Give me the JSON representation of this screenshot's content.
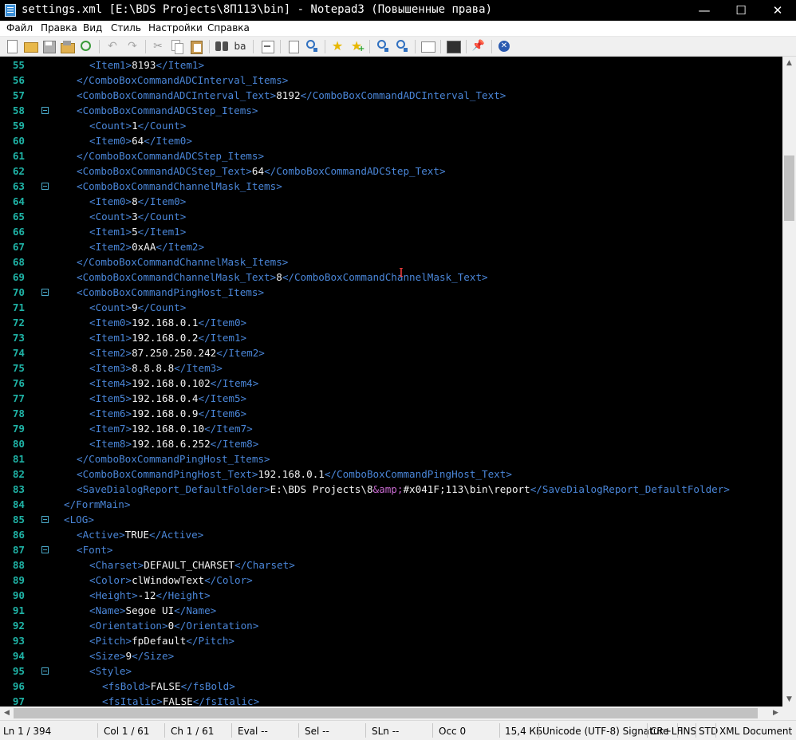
{
  "window": {
    "title": "settings.xml [E:\\BDS Projects\\8П113\\bin] - Notepad3 (Повышенные права)",
    "minimize_glyph": "—",
    "maximize_glyph": "☐",
    "close_glyph": "✕"
  },
  "menu": {
    "items": [
      "Файл",
      "Правка",
      "Вид",
      "Стиль",
      "Настройки",
      "Справка"
    ]
  },
  "toolbar": {
    "icons": [
      "new-file-icon",
      "open-folder-icon",
      "save-icon",
      "save-as-icon",
      "revert-icon",
      "undo-icon",
      "redo-icon",
      "cut-icon",
      "copy-icon",
      "paste-icon",
      "find-icon",
      "replace-icon",
      "word-wrap-icon",
      "goto-icon",
      "search-web-icon",
      "favorite-star-icon",
      "add-favorite-icon",
      "zoom-in-icon",
      "zoom-out-icon",
      "schema-icon",
      "console-icon",
      "pin-icon",
      "close-document-icon"
    ]
  },
  "editor": {
    "lines": [
      {
        "n": "55",
        "fold": false,
        "indent": 2,
        "tokens": [
          [
            "tag",
            "<Item1>"
          ],
          [
            "val",
            "8193"
          ],
          [
            "tag",
            "</Item1>"
          ]
        ]
      },
      {
        "n": "56",
        "fold": false,
        "indent": 1,
        "tokens": [
          [
            "tag",
            "</ComboBoxCommandADCInterval_Items>"
          ]
        ]
      },
      {
        "n": "57",
        "fold": false,
        "indent": 1,
        "tokens": [
          [
            "tag",
            "<ComboBoxCommandADCInterval_Text>"
          ],
          [
            "val",
            "8192"
          ],
          [
            "tag",
            "</ComboBoxCommandADCInterval_Text>"
          ]
        ]
      },
      {
        "n": "58",
        "fold": true,
        "indent": 1,
        "tokens": [
          [
            "tag",
            "<ComboBoxCommandADCStep_Items>"
          ]
        ]
      },
      {
        "n": "59",
        "fold": false,
        "indent": 2,
        "tokens": [
          [
            "tag",
            "<Count>"
          ],
          [
            "val",
            "1"
          ],
          [
            "tag",
            "</Count>"
          ]
        ]
      },
      {
        "n": "60",
        "fold": false,
        "indent": 2,
        "tokens": [
          [
            "tag",
            "<Item0>"
          ],
          [
            "val",
            "64"
          ],
          [
            "tag",
            "</Item0>"
          ]
        ]
      },
      {
        "n": "61",
        "fold": false,
        "indent": 1,
        "tokens": [
          [
            "tag",
            "</ComboBoxCommandADCStep_Items>"
          ]
        ]
      },
      {
        "n": "62",
        "fold": false,
        "indent": 1,
        "tokens": [
          [
            "tag",
            "<ComboBoxCommandADCStep_Text>"
          ],
          [
            "val",
            "64"
          ],
          [
            "tag",
            "</ComboBoxCommandADCStep_Text>"
          ]
        ]
      },
      {
        "n": "63",
        "fold": true,
        "indent": 1,
        "tokens": [
          [
            "tag",
            "<ComboBoxCommandChannelMask_Items>"
          ]
        ]
      },
      {
        "n": "64",
        "fold": false,
        "indent": 2,
        "tokens": [
          [
            "tag",
            "<Item0>"
          ],
          [
            "val",
            "8"
          ],
          [
            "tag",
            "</Item0>"
          ]
        ]
      },
      {
        "n": "65",
        "fold": false,
        "indent": 2,
        "tokens": [
          [
            "tag",
            "<Count>"
          ],
          [
            "val",
            "3"
          ],
          [
            "tag",
            "</Count>"
          ]
        ]
      },
      {
        "n": "66",
        "fold": false,
        "indent": 2,
        "tokens": [
          [
            "tag",
            "<Item1>"
          ],
          [
            "val",
            "5"
          ],
          [
            "tag",
            "</Item1>"
          ]
        ]
      },
      {
        "n": "67",
        "fold": false,
        "indent": 2,
        "tokens": [
          [
            "tag",
            "<Item2>"
          ],
          [
            "val",
            "0xAA"
          ],
          [
            "tag",
            "</Item2>"
          ]
        ]
      },
      {
        "n": "68",
        "fold": false,
        "indent": 1,
        "tokens": [
          [
            "tag",
            "</ComboBoxCommandChannelMask_Items>"
          ]
        ]
      },
      {
        "n": "69",
        "fold": false,
        "indent": 1,
        "tokens": [
          [
            "tag",
            "<ComboBoxCommandChannelMask_Text>"
          ],
          [
            "val",
            "8"
          ],
          [
            "tag",
            "</ComboBoxCommandChannelMask_Text>"
          ]
        ]
      },
      {
        "n": "70",
        "fold": true,
        "indent": 1,
        "tokens": [
          [
            "tag",
            "<ComboBoxCommandPingHost_Items>"
          ]
        ]
      },
      {
        "n": "71",
        "fold": false,
        "indent": 2,
        "tokens": [
          [
            "tag",
            "<Count>"
          ],
          [
            "val",
            "9"
          ],
          [
            "tag",
            "</Count>"
          ]
        ]
      },
      {
        "n": "72",
        "fold": false,
        "indent": 2,
        "tokens": [
          [
            "tag",
            "<Item0>"
          ],
          [
            "val",
            "192.168.0.1"
          ],
          [
            "tag",
            "</Item0>"
          ]
        ]
      },
      {
        "n": "73",
        "fold": false,
        "indent": 2,
        "tokens": [
          [
            "tag",
            "<Item1>"
          ],
          [
            "val",
            "192.168.0.2"
          ],
          [
            "tag",
            "</Item1>"
          ]
        ]
      },
      {
        "n": "74",
        "fold": false,
        "indent": 2,
        "tokens": [
          [
            "tag",
            "<Item2>"
          ],
          [
            "val",
            "87.250.250.242"
          ],
          [
            "tag",
            "</Item2>"
          ]
        ]
      },
      {
        "n": "75",
        "fold": false,
        "indent": 2,
        "tokens": [
          [
            "tag",
            "<Item3>"
          ],
          [
            "val",
            "8.8.8.8"
          ],
          [
            "tag",
            "</Item3>"
          ]
        ]
      },
      {
        "n": "76",
        "fold": false,
        "indent": 2,
        "tokens": [
          [
            "tag",
            "<Item4>"
          ],
          [
            "val",
            "192.168.0.102"
          ],
          [
            "tag",
            "</Item4>"
          ]
        ]
      },
      {
        "n": "77",
        "fold": false,
        "indent": 2,
        "tokens": [
          [
            "tag",
            "<Item5>"
          ],
          [
            "val",
            "192.168.0.4"
          ],
          [
            "tag",
            "</Item5>"
          ]
        ]
      },
      {
        "n": "78",
        "fold": false,
        "indent": 2,
        "tokens": [
          [
            "tag",
            "<Item6>"
          ],
          [
            "val",
            "192.168.0.9"
          ],
          [
            "tag",
            "</Item6>"
          ]
        ]
      },
      {
        "n": "79",
        "fold": false,
        "indent": 2,
        "tokens": [
          [
            "tag",
            "<Item7>"
          ],
          [
            "val",
            "192.168.0.10"
          ],
          [
            "tag",
            "</Item7>"
          ]
        ]
      },
      {
        "n": "80",
        "fold": false,
        "indent": 2,
        "tokens": [
          [
            "tag",
            "<Item8>"
          ],
          [
            "val",
            "192.168.6.252"
          ],
          [
            "tag",
            "</Item8>"
          ]
        ]
      },
      {
        "n": "81",
        "fold": false,
        "indent": 1,
        "tokens": [
          [
            "tag",
            "</ComboBoxCommandPingHost_Items>"
          ]
        ]
      },
      {
        "n": "82",
        "fold": false,
        "indent": 1,
        "tokens": [
          [
            "tag",
            "<ComboBoxCommandPingHost_Text>"
          ],
          [
            "val",
            "192.168.0.1"
          ],
          [
            "tag",
            "</ComboBoxCommandPingHost_Text>"
          ]
        ]
      },
      {
        "n": "83",
        "fold": false,
        "indent": 1,
        "tokens": [
          [
            "tag",
            "<SaveDialogReport_DefaultFolder>"
          ],
          [
            "val",
            "E:\\BDS Projects\\8"
          ],
          [
            "ent",
            "&amp;"
          ],
          [
            "val",
            "#x041F;113\\bin\\report"
          ],
          [
            "tag",
            "</SaveDialogReport_DefaultFolder>"
          ]
        ]
      },
      {
        "n": "84",
        "fold": false,
        "indent": 0,
        "tokens": [
          [
            "tag",
            "</FormMain>"
          ]
        ]
      },
      {
        "n": "85",
        "fold": true,
        "indent": 0,
        "tokens": [
          [
            "tag",
            "<LOG>"
          ]
        ]
      },
      {
        "n": "86",
        "fold": false,
        "indent": 1,
        "tokens": [
          [
            "tag",
            "<Active>"
          ],
          [
            "val",
            "TRUE"
          ],
          [
            "tag",
            "</Active>"
          ]
        ]
      },
      {
        "n": "87",
        "fold": true,
        "indent": 1,
        "tokens": [
          [
            "tag",
            "<Font>"
          ]
        ]
      },
      {
        "n": "88",
        "fold": false,
        "indent": 2,
        "tokens": [
          [
            "tag",
            "<Charset>"
          ],
          [
            "val",
            "DEFAULT_CHARSET"
          ],
          [
            "tag",
            "</Charset>"
          ]
        ]
      },
      {
        "n": "89",
        "fold": false,
        "indent": 2,
        "tokens": [
          [
            "tag",
            "<Color>"
          ],
          [
            "val",
            "clWindowText"
          ],
          [
            "tag",
            "</Color>"
          ]
        ]
      },
      {
        "n": "90",
        "fold": false,
        "indent": 2,
        "tokens": [
          [
            "tag",
            "<Height>"
          ],
          [
            "val",
            "-12"
          ],
          [
            "tag",
            "</Height>"
          ]
        ]
      },
      {
        "n": "91",
        "fold": false,
        "indent": 2,
        "tokens": [
          [
            "tag",
            "<Name>"
          ],
          [
            "val",
            "Segoe UI"
          ],
          [
            "tag",
            "</Name>"
          ]
        ]
      },
      {
        "n": "92",
        "fold": false,
        "indent": 2,
        "tokens": [
          [
            "tag",
            "<Orientation>"
          ],
          [
            "val",
            "0"
          ],
          [
            "tag",
            "</Orientation>"
          ]
        ]
      },
      {
        "n": "93",
        "fold": false,
        "indent": 2,
        "tokens": [
          [
            "tag",
            "<Pitch>"
          ],
          [
            "val",
            "fpDefault"
          ],
          [
            "tag",
            "</Pitch>"
          ]
        ]
      },
      {
        "n": "94",
        "fold": false,
        "indent": 2,
        "tokens": [
          [
            "tag",
            "<Size>"
          ],
          [
            "val",
            "9"
          ],
          [
            "tag",
            "</Size>"
          ]
        ]
      },
      {
        "n": "95",
        "fold": true,
        "indent": 2,
        "tokens": [
          [
            "tag",
            "<Style>"
          ]
        ]
      },
      {
        "n": "96",
        "fold": false,
        "indent": 3,
        "tokens": [
          [
            "tag",
            "<fsBold>"
          ],
          [
            "val",
            "FALSE"
          ],
          [
            "tag",
            "</fsBold>"
          ]
        ]
      },
      {
        "n": "97",
        "fold": false,
        "indent": 3,
        "tokens": [
          [
            "tag",
            "<fsItalic>"
          ],
          [
            "val",
            "FALSE"
          ],
          [
            "tag",
            "</fsItalic>"
          ]
        ]
      }
    ]
  },
  "statusbar": {
    "ln": "Ln 1 / 394",
    "col": "Col 1 / 61",
    "ch": "Ch 1 / 61",
    "eval": "Eval --",
    "sel": "Sel --",
    "sln": "SLn --",
    "occ": "Occ 0",
    "size": "15,4 КБ",
    "encoding": "Unicode (UTF-8) Signature",
    "eol": "CR+LF",
    "ins": "INS",
    "std": "STD",
    "lexer": "XML Document"
  },
  "colors": {
    "tag": "#4a86d8",
    "value": "#f2f2f2",
    "entity": "#c86ad0",
    "line_number": "#1fb3a6",
    "background": "#000000"
  }
}
